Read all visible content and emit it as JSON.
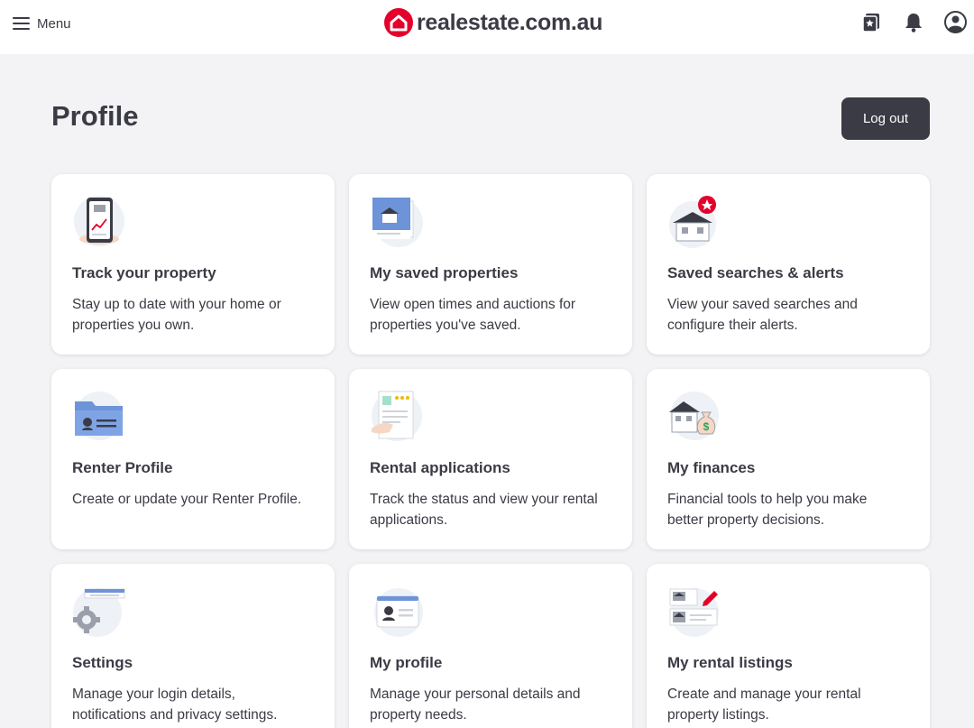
{
  "header": {
    "menu_label": "Menu",
    "logo_text": "realestate.com.au",
    "brand_color": "#e4002b",
    "icons": [
      "saved-star-icon",
      "bell-icon",
      "account-icon"
    ]
  },
  "page": {
    "title": "Profile",
    "logout_label": "Log out"
  },
  "cards": [
    {
      "title": "Track your property",
      "description": "Stay up to date with your home or properties you own.",
      "icon": "phone-chart-icon"
    },
    {
      "title": "My saved properties",
      "description": "View open times and auctions for properties you've saved.",
      "icon": "saved-house-photo-icon"
    },
    {
      "title": "Saved searches & alerts",
      "description": "View your saved searches and configure their alerts.",
      "icon": "house-alert-icon"
    },
    {
      "title": "Renter Profile",
      "description": "Create or update your Renter Profile.",
      "icon": "renter-folder-icon"
    },
    {
      "title": "Rental applications",
      "description": "Track the status and view your rental applications.",
      "icon": "application-document-icon"
    },
    {
      "title": "My finances",
      "description": "Financial tools to help you make better property decisions.",
      "icon": "house-money-bag-icon"
    },
    {
      "title": "Settings",
      "description": "Manage your login details, notifications and privacy settings.",
      "icon": "gear-settings-icon"
    },
    {
      "title": "My profile",
      "description": "Manage your personal details and property needs.",
      "icon": "profile-card-icon"
    },
    {
      "title": "My rental listings",
      "description": "Create and manage your rental property listings.",
      "icon": "listing-edit-icon"
    }
  ]
}
